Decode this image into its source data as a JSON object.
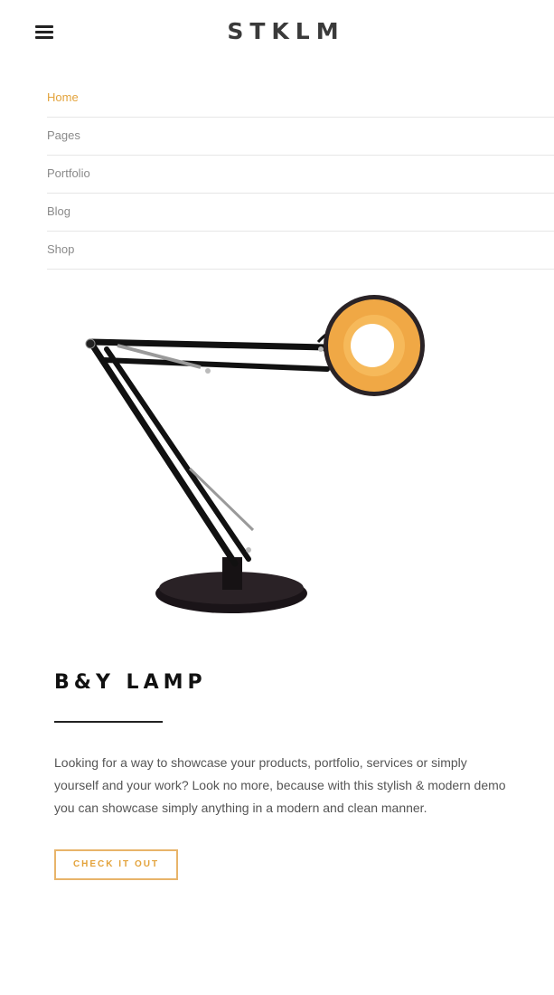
{
  "header": {
    "logo": "STKLM",
    "menu_icon": "hamburger-icon"
  },
  "nav": {
    "items": [
      {
        "label": "Home",
        "active": true
      },
      {
        "label": "Pages",
        "active": false
      },
      {
        "label": "Portfolio",
        "active": false
      },
      {
        "label": "Blog",
        "active": false
      },
      {
        "label": "Shop",
        "active": false
      }
    ]
  },
  "product": {
    "image": "desk-lamp-image",
    "title": "B&Y LAMP",
    "description": "Looking for a way to showcase your products, portfolio, services or simply yourself and your work? Look no more, because with this stylish & modern demo you can showcase simply anything in a modern and clean manner.",
    "cta_label": "CHECK IT OUT"
  },
  "colors": {
    "accent": "#e3a33c",
    "text_dark": "#111111",
    "text_muted": "#8a8a8a",
    "divider": "#e6e6e6",
    "lamp_shade": "#f0a845"
  }
}
